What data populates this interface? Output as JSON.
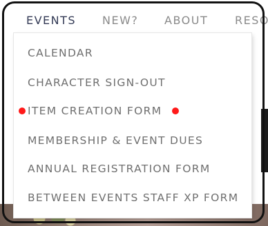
{
  "nav": {
    "items": [
      {
        "label": "EVENTS"
      },
      {
        "label": "NEW?"
      },
      {
        "label": "ABOUT"
      },
      {
        "label": "RESO"
      }
    ]
  },
  "dropdown": {
    "items": [
      {
        "label": "CALENDAR"
      },
      {
        "label": "CHARACTER SIGN-OUT"
      },
      {
        "label": "ITEM CREATION FORM"
      },
      {
        "label": "MEMBERSHIP & EVENT DUES"
      },
      {
        "label": "ANNUAL REGISTRATION FORM"
      },
      {
        "label": "BETWEEN EVENTS STAFF XP FORM"
      }
    ]
  },
  "colors": {
    "nav_active": "#333a55",
    "nav_inactive": "#8a8a8a",
    "menu_text": "#6f6f6f",
    "marker": "#ff1a1a"
  }
}
